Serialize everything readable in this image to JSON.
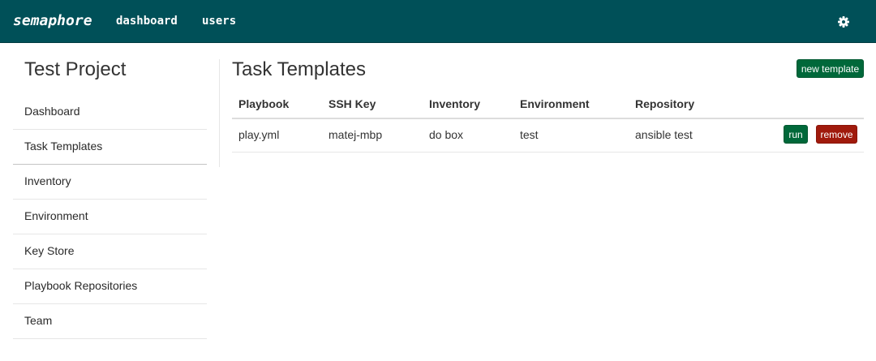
{
  "nav": {
    "brand": "semaphore",
    "links": [
      "dashboard",
      "users"
    ],
    "settings_icon": "gear-icon"
  },
  "sidebar": {
    "project_title": "Test Project",
    "items": [
      {
        "label": "Dashboard"
      },
      {
        "label": "Task Templates",
        "active": true
      },
      {
        "label": "Inventory"
      },
      {
        "label": "Environment"
      },
      {
        "label": "Key Store"
      },
      {
        "label": "Playbook Repositories"
      },
      {
        "label": "Team"
      }
    ]
  },
  "main": {
    "title": "Task Templates",
    "new_button": "new template",
    "table": {
      "headers": [
        "Playbook",
        "SSH Key",
        "Inventory",
        "Environment",
        "Repository"
      ],
      "rows": [
        {
          "cells": [
            "play.yml",
            "matej-mbp",
            "do box",
            "test",
            "ansible test"
          ],
          "run_label": "run",
          "remove_label": "remove"
        }
      ]
    }
  },
  "colors": {
    "navbar": "#005058",
    "primary_button": "#00683a",
    "danger_button": "#a01a0c"
  }
}
